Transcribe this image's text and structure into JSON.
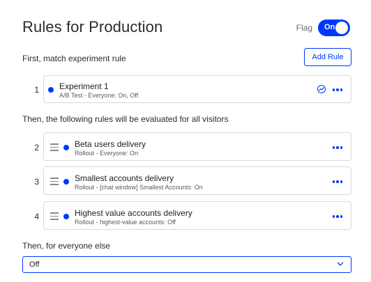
{
  "header": {
    "title": "Rules for Production",
    "flag_label": "Flag",
    "toggle_label": "On"
  },
  "experiment_section": {
    "label": "First, match experiment rule",
    "add_rule_label": "Add Rule",
    "rule": {
      "number": "1",
      "name": "Experiment 1",
      "details": "A/B Test - Everyone: On, Off"
    }
  },
  "rollout_section": {
    "label": "Then, the following rules will be evaluated for all visitors",
    "rules": [
      {
        "number": "2",
        "name": "Beta users delivery",
        "details": "Rollout - Everyone: On"
      },
      {
        "number": "3",
        "name": "Smallest accounts delivery",
        "details": "Rollout - [chat window] Smallest Accounts: On"
      },
      {
        "number": "4",
        "name": "Highest value accounts delivery",
        "details": "Rollout - highest-value accounts: Off"
      }
    ]
  },
  "everyone_else": {
    "label": "Then, for everyone else",
    "selected_value": "Off"
  },
  "colors": {
    "accent": "#0037ff",
    "border": "#d9d9d9"
  },
  "icons": [
    "more-options-icon",
    "results-graph-icon",
    "drag-handle-icon",
    "chevron-down-icon"
  ]
}
